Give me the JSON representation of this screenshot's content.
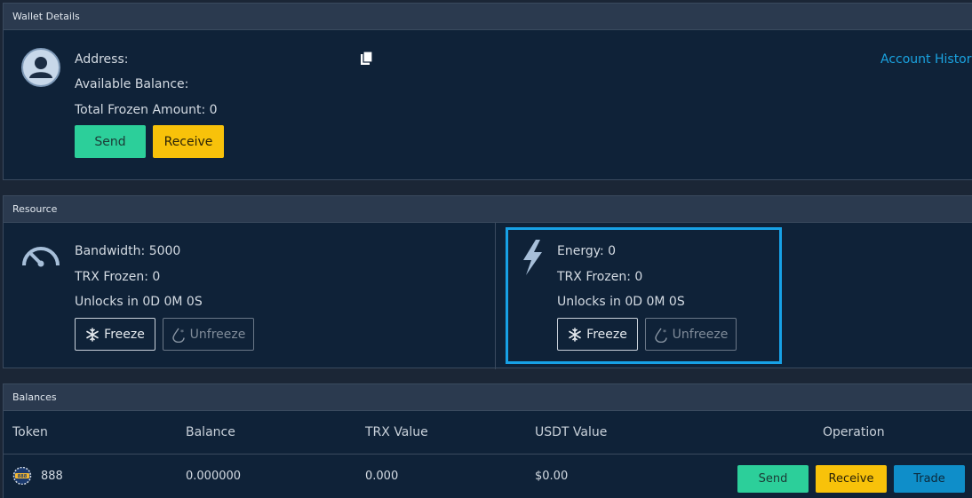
{
  "wallet": {
    "header": "Wallet Details",
    "address_label": "Address:",
    "balance_label": "Available Balance:",
    "frozen_label": "Total Frozen Amount: 0",
    "send_label": "Send",
    "receive_label": "Receive",
    "history_link": "Account History"
  },
  "resource": {
    "header": "Resource",
    "bandwidth": {
      "title": "Bandwidth: 5000",
      "frozen": "TRX Frozen: 0",
      "unlocks": "Unlocks in 0D 0M 0S",
      "freeze_label": "Freeze",
      "unfreeze_label": "Unfreeze"
    },
    "energy": {
      "title": "Energy: 0",
      "frozen": "TRX Frozen: 0",
      "unlocks": "Unlocks in 0D 0M 0S",
      "freeze_label": "Freeze",
      "unfreeze_label": "Unfreeze"
    }
  },
  "balances": {
    "header": "Balances",
    "columns": [
      "Token",
      "Balance",
      "TRX Value",
      "USDT Value",
      "Operation"
    ],
    "rows": [
      {
        "token": "888",
        "balance": "0.000000",
        "trx_value": "0.000",
        "usdt_value": "$0.00",
        "send_label": "Send",
        "receive_label": "Receive",
        "trade_label": "Trade"
      }
    ]
  },
  "colors": {
    "accent": "#17a1e6",
    "send": "#2ccf9a",
    "receive": "#f8c20a",
    "trade": "#0f8ec9",
    "panel_bg": "#0f2238",
    "header_bg": "#2b3a4f"
  }
}
